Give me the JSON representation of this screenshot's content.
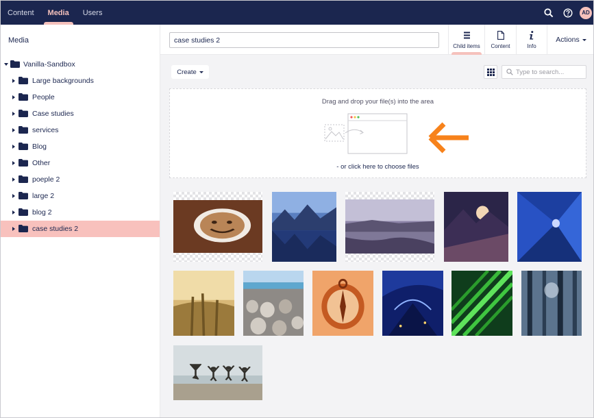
{
  "topnav": {
    "items": [
      {
        "label": "Content",
        "active": false
      },
      {
        "label": "Media",
        "active": true
      },
      {
        "label": "Users",
        "active": false
      }
    ],
    "avatar_initials": "AD",
    "icons": [
      "search-icon",
      "help-icon"
    ]
  },
  "sidebar": {
    "title": "Media",
    "root": {
      "label": "Vanilla-Sandbox",
      "expanded": true
    },
    "items": [
      {
        "label": "Large backgrounds",
        "selected": false
      },
      {
        "label": "People",
        "selected": false
      },
      {
        "label": "Case studies",
        "selected": false
      },
      {
        "label": "services",
        "selected": false
      },
      {
        "label": "Blog",
        "selected": false
      },
      {
        "label": "Other",
        "selected": false
      },
      {
        "label": "poeple 2",
        "selected": false
      },
      {
        "label": "large 2",
        "selected": false
      },
      {
        "label": "blog 2",
        "selected": false
      },
      {
        "label": "case studies 2",
        "selected": true
      }
    ]
  },
  "header": {
    "name_value": "case studies 2",
    "tabs": [
      {
        "label": "Child items",
        "icon": "list-icon",
        "active": true
      },
      {
        "label": "Content",
        "icon": "document-icon",
        "active": false
      },
      {
        "label": "Info",
        "icon": "info-icon",
        "active": false
      }
    ],
    "actions_label": "Actions"
  },
  "toolbar": {
    "create_label": "Create",
    "search_placeholder": "Type to search..."
  },
  "dropzone": {
    "title": "Drag and drop your file(s) into the area",
    "subtitle": "- or click here to choose files"
  },
  "media": {
    "items": [
      {
        "name": "coffee-smiley-image"
      },
      {
        "name": "mountain-lake-image"
      },
      {
        "name": "rocky-coast-image"
      },
      {
        "name": "mountain-sunset-image"
      },
      {
        "name": "blue-tunnel-image"
      },
      {
        "name": "wheat-field-image"
      },
      {
        "name": "beach-pebbles-image"
      },
      {
        "name": "orange-compass-image"
      },
      {
        "name": "night-bridge-image"
      },
      {
        "name": "green-palm-leaf-image"
      },
      {
        "name": "misty-forest-image"
      },
      {
        "name": "people-jumping-beach-image"
      }
    ]
  },
  "colors": {
    "topbar": "#1b264f",
    "accent_pink": "#f5c1bc",
    "selected_row": "#f8c1bd",
    "arrow_orange": "#f7821b",
    "main_bg": "#f3f3f5"
  }
}
